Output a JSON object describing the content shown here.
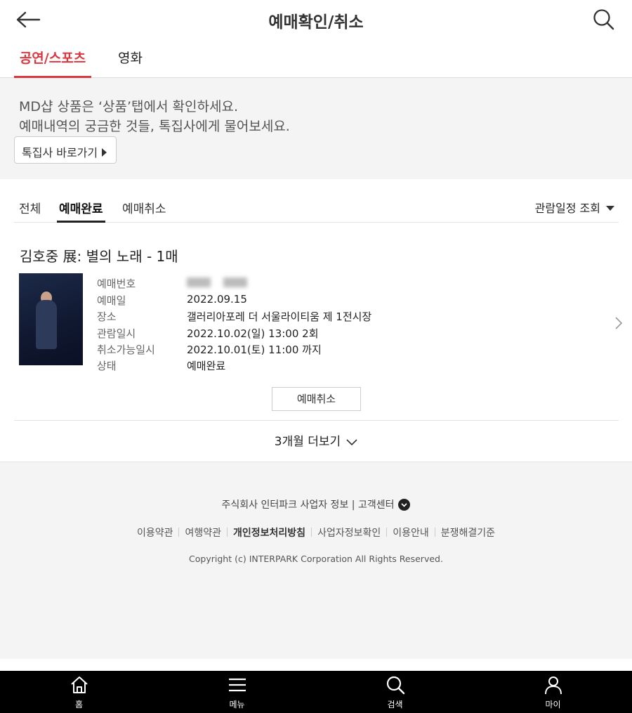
{
  "header": {
    "title": "예매확인/취소"
  },
  "category_tabs": [
    {
      "label": "공연/스포츠",
      "active": true
    },
    {
      "label": "영화",
      "active": false
    }
  ],
  "notice": {
    "line1": "MD샵 상품은 ‘상품’탭에서 확인하세요.",
    "line2": "예매내역의 궁금한 것들, 톡집사에게 물어보세요.",
    "button": "톡집사 바로가기"
  },
  "status_tabs": [
    {
      "label": "전체",
      "active": false
    },
    {
      "label": "예매완료",
      "active": true
    },
    {
      "label": "예매취소",
      "active": false
    }
  ],
  "sort": {
    "label": "관람일정 조회"
  },
  "booking": {
    "title": "김호중 展: 별의 노래 - 1매",
    "rows": [
      {
        "label": "예매번호",
        "value": ""
      },
      {
        "label": "예매일",
        "value": "2022.09.15"
      },
      {
        "label": "장소",
        "value": "갤러리아포레 더 서울라이티움 제 1전시장"
      },
      {
        "label": "관람일시",
        "value": "2022.10.02(일) 13:00 2회"
      },
      {
        "label": "취소가능일시",
        "value": "2022.10.01(토) 11:00 까지"
      },
      {
        "label": "상태",
        "value": "예매완료"
      }
    ],
    "cancel_button": "예매취소"
  },
  "more_button": "3개월 더보기",
  "footer": {
    "company": "주식회사 인터파크 사업자 정보 | 고객센터",
    "links": [
      "이용약관",
      "여행약관",
      "개인정보처리방침",
      "사업자정보확인",
      "이용안내",
      "분쟁해결기준"
    ],
    "copyright": "Copyright (c) INTERPARK Corporation All Rights Reserved."
  },
  "bottom_nav": [
    {
      "label": "홈",
      "icon": "home-icon"
    },
    {
      "label": "메뉴",
      "icon": "menu-icon"
    },
    {
      "label": "검색",
      "icon": "search-icon"
    },
    {
      "label": "마이",
      "icon": "user-icon"
    }
  ],
  "colors": {
    "accent": "#d9383f",
    "nav_bg": "#000000",
    "notice_bg": "#f4f4f4"
  }
}
